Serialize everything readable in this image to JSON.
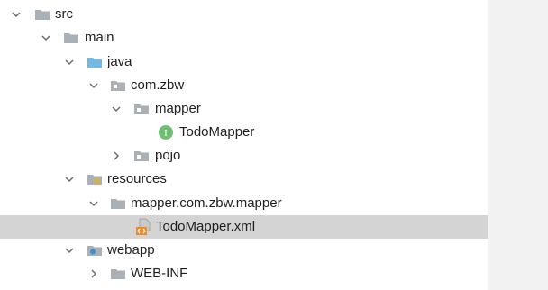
{
  "tree": {
    "items": [
      {
        "label": "src",
        "icon": "folder-icon",
        "state": "expanded"
      },
      {
        "label": "main",
        "icon": "folder-icon",
        "state": "expanded"
      },
      {
        "label": "java",
        "icon": "source-root-folder-icon",
        "state": "expanded"
      },
      {
        "label": "com.zbw",
        "icon": "package-icon",
        "state": "expanded"
      },
      {
        "label": "mapper",
        "icon": "package-icon",
        "state": "expanded"
      },
      {
        "label": "TodoMapper",
        "icon": "interface-icon",
        "state": "leaf"
      },
      {
        "label": "pojo",
        "icon": "package-icon",
        "state": "collapsed"
      },
      {
        "label": "resources",
        "icon": "resources-folder-icon",
        "state": "expanded"
      },
      {
        "label": "mapper.com.zbw.mapper",
        "icon": "folder-icon",
        "state": "expanded"
      },
      {
        "label": "TodoMapper.xml",
        "icon": "xml-file-icon",
        "state": "leaf",
        "selected": true
      },
      {
        "label": "webapp",
        "icon": "web-folder-icon",
        "state": "expanded"
      },
      {
        "label": "WEB-INF",
        "icon": "folder-icon",
        "state": "collapsed"
      }
    ],
    "interface_badge_letter": "I"
  },
  "colors": {
    "folder": "#a9b0b6",
    "source_folder": "#73b9e6",
    "interface_badge": "#6fbf73",
    "selection": "#d4d4d4",
    "side_panel": "#f2f2f2"
  }
}
